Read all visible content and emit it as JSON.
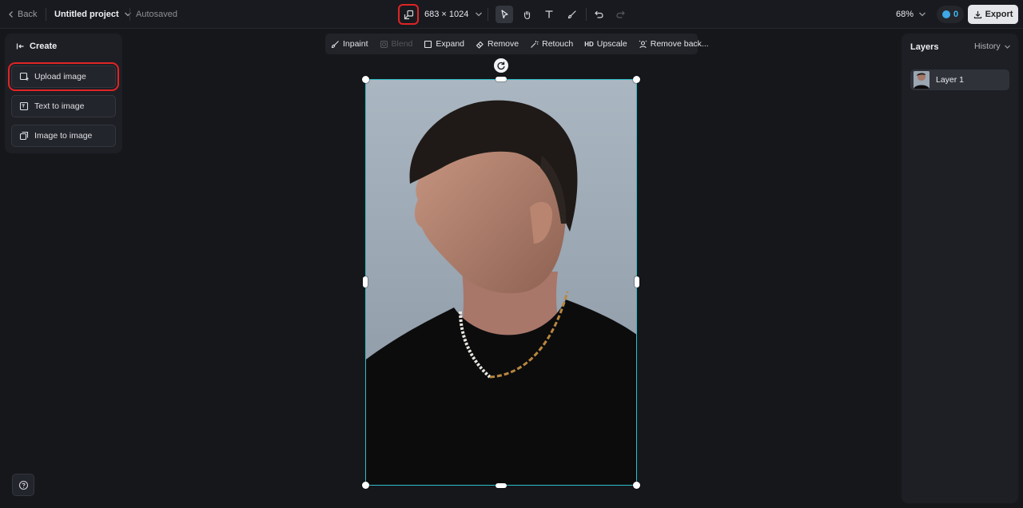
{
  "topbar": {
    "back_label": "Back",
    "project_name": "Untitled project",
    "save_status": "Autosaved",
    "canvas_size": "683 × 1024",
    "zoom_level": "68%",
    "credits": "0",
    "export_label": "Export"
  },
  "left_panel": {
    "title": "Create",
    "items": [
      {
        "label": "Upload image",
        "icon": "upload-image-icon"
      },
      {
        "label": "Text to image",
        "icon": "text-to-image-icon"
      },
      {
        "label": "Image to image",
        "icon": "image-to-image-icon"
      }
    ]
  },
  "edit_toolbar": {
    "tools": [
      {
        "label": "Inpaint",
        "icon": "inpaint-brush-icon",
        "enabled": true
      },
      {
        "label": "Blend",
        "icon": "blend-icon",
        "enabled": false
      },
      {
        "label": "Expand",
        "icon": "expand-icon",
        "enabled": true
      },
      {
        "label": "Remove",
        "icon": "eraser-icon",
        "enabled": true
      },
      {
        "label": "Retouch",
        "icon": "magic-wand-icon",
        "enabled": true
      },
      {
        "label": "Upscale",
        "icon": "hd-icon",
        "enabled": true
      },
      {
        "label": "Remove back...",
        "icon": "remove-background-icon",
        "enabled": true
      }
    ],
    "hd_text": "HD"
  },
  "right_panel": {
    "title": "Layers",
    "history_label": "History",
    "layers": [
      {
        "name": "Layer 1"
      }
    ]
  },
  "colors": {
    "accent_selection": "#2dbfc9",
    "highlight_red": "#e02424",
    "background": "#16171b"
  }
}
